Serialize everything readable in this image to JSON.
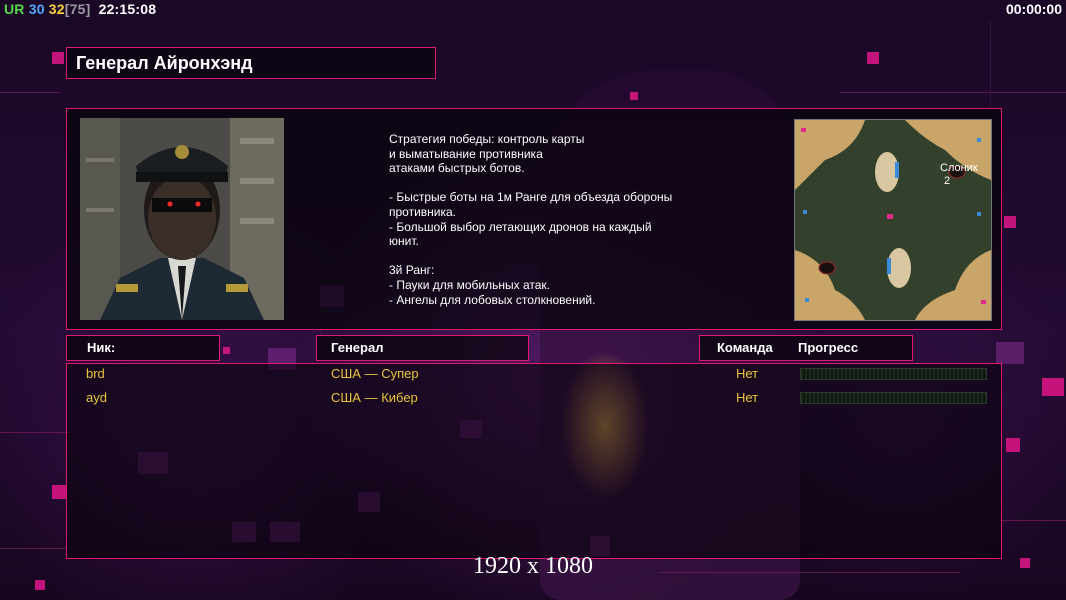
{
  "hud": {
    "ur_label": "UR",
    "value1": "30",
    "value2": "32",
    "value3": "[75]",
    "clock": "22:15:08",
    "game_timer": "00:00:00"
  },
  "general": {
    "name": "Генерал Айронхэнд",
    "description": "Стратегия победы: контроль карты\nи выматывание противника\nатаками быстрых ботов.\n\n- Быстрые боты на 1м Ранге для объезда обороны\n противника.\n- Большой выбор летающих дронов на каждый\n юнит.\n\n3й Ранг:\n- Пауки для мобильных атак.\n- Ангелы для лобовых столкновений."
  },
  "map": {
    "name": "Слоник",
    "players": "2"
  },
  "table": {
    "headers": {
      "nick": "Ник:",
      "general": "Генерал",
      "team": "Команда",
      "progress": "Прогресс"
    },
    "rows": [
      {
        "nick": "brd",
        "general": "США — Супер",
        "team": "Нет",
        "progress": 0
      },
      {
        "nick": "ayd",
        "general": "США — Кибер",
        "team": "Нет",
        "progress": 0
      }
    ]
  },
  "resolution": "1920 x 1080",
  "colors": {
    "accent": "#e0186e",
    "player_text": "#e8c63a"
  }
}
